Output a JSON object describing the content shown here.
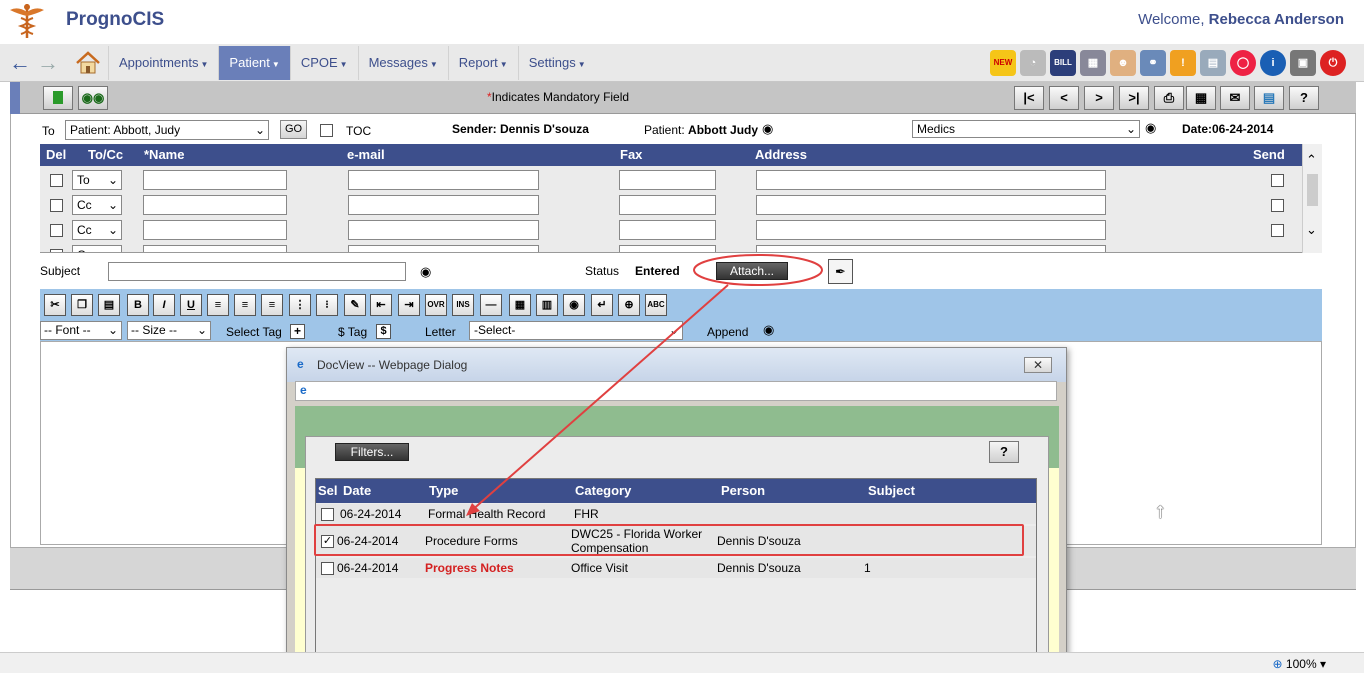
{
  "header": {
    "app_title": "PrognoCIS",
    "welcome_prefix": "Welcome,",
    "user_name": "Rebecca Anderson"
  },
  "nav": {
    "menu": [
      {
        "label": "Appointments",
        "active": false
      },
      {
        "label": "Patient",
        "active": true
      },
      {
        "label": "CPOE",
        "active": false
      },
      {
        "label": "Messages",
        "active": false
      },
      {
        "label": "Report",
        "active": false
      },
      {
        "label": "Settings",
        "active": false
      }
    ],
    "tool_icons": [
      "new-icon",
      "speedometer-icon",
      "bill-icon",
      "calendar-icon",
      "user-icon",
      "stethoscope-icon",
      "alert-mail-icon",
      "documents-icon",
      "lifebuoy-icon",
      "info-icon",
      "lock-icon",
      "power-icon"
    ]
  },
  "action_bar": {
    "mandatory_star": "*",
    "mandatory_text": "Indicates Mandatory Field",
    "left_buttons": [
      "new-document-icon",
      "binoculars-icon"
    ],
    "right_buttons": [
      "|<",
      "<",
      ">",
      ">|",
      "print-icon",
      "calculator-icon",
      "envelope-icon",
      "export-icon",
      "?"
    ]
  },
  "compose": {
    "to_label": "To",
    "to_value": "Patient: Abbott, Judy",
    "go_label": "GO",
    "toc_label": "TOC",
    "sender_label": "Sender: Dennis D'souza",
    "patient_prefix": "Patient:",
    "patient_name": "Abbott Judy",
    "medics_value": "Medics",
    "date_label": "Date:06-24-2014",
    "subject_label": "Subject",
    "status_label": "Status",
    "status_value": "Entered",
    "attach_label": "Attach..."
  },
  "recipients": {
    "columns": [
      "Del",
      "To/Cc",
      "*Name",
      "e-mail",
      "Fax",
      "Address",
      "Send"
    ],
    "rows": [
      {
        "type": "To"
      },
      {
        "type": "Cc"
      },
      {
        "type": "Cc"
      },
      {
        "type": "Cc"
      }
    ]
  },
  "editor_toolbar": {
    "buttons": [
      "cut-icon",
      "copy-icon",
      "paste-icon",
      "B",
      "I",
      "U",
      "align-left-icon",
      "align-center-icon",
      "align-right-icon",
      "ordered-list-icon",
      "unordered-list-icon",
      "spell-icon",
      "outdent-icon",
      "indent-icon",
      "OVR",
      "INS",
      "hr-icon",
      "table-icon",
      "table-edit-icon",
      "find-icon",
      "line-break-icon",
      "zoom-icon",
      "ABC"
    ],
    "font_select": "-- Font --",
    "size_select": "-- Size --",
    "select_tag_label": "Select Tag",
    "dollar_tag_label": "$ Tag",
    "letter_label": "Letter",
    "letter_select": "-Select-",
    "append_label": "Append"
  },
  "dialog": {
    "title": "DocView -- Webpage Dialog",
    "filters_label": "Filters...",
    "help_label": "?",
    "columns": [
      "Sel",
      "Date",
      "Type",
      "Category",
      "Person",
      "Subject"
    ],
    "rows": [
      {
        "checked": false,
        "date": "06-24-2014",
        "type": "Formal Health Record",
        "category": "FHR",
        "person": "",
        "subject": "",
        "type_color": "#000000"
      },
      {
        "checked": true,
        "date": "06-24-2014",
        "type": "Procedure Forms",
        "category": "DWC25 - Florida Worker Compensation",
        "person": "Dennis D'souza",
        "subject": "",
        "type_color": "#000000"
      },
      {
        "checked": false,
        "date": "06-24-2014",
        "type": "Progress Notes",
        "category": "Office Visit",
        "person": "Dennis D'souza",
        "subject": "1",
        "type_color": "#d42020"
      }
    ]
  },
  "statusbar": {
    "zoom": "100%"
  },
  "colors": {
    "brand": "#3d4f8c",
    "active_menu": "#6a7fb9",
    "highlight": "#e04040"
  }
}
